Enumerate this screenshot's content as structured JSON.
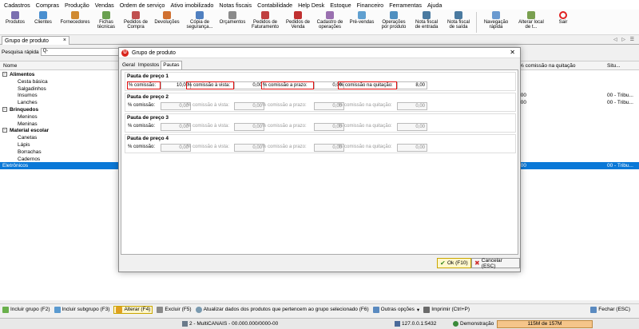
{
  "menubar": [
    "Cadastros",
    "Compras",
    "Produção",
    "Vendas",
    "Ordem de serviço",
    "Ativo imobilizado",
    "Notas fiscais",
    "Contabilidade",
    "Help Desk",
    "Estoque",
    "Financeiro",
    "Ferramentas",
    "Ajuda"
  ],
  "toolbar": [
    {
      "label": "Produtos",
      "icon": "box-icon",
      "color": "#7a6fb0"
    },
    {
      "label": "Clientes",
      "icon": "user-icon",
      "color": "#4a8fd0"
    },
    {
      "label": "Fornecedores",
      "icon": "truck-icon",
      "color": "#d08a30"
    },
    {
      "label": "Fichas\ntécnicas",
      "icon": "sheet-icon",
      "color": "#6aa050"
    },
    {
      "label": "Pedidos de\nCompra",
      "icon": "cart-icon",
      "color": "#c05050"
    },
    {
      "label": "Devoluções",
      "icon": "return-icon",
      "color": "#d07030"
    },
    {
      "label": "Cópia de\nsegurança...",
      "icon": "backup-icon",
      "color": "#5080c0"
    },
    {
      "label": "Orçamentos",
      "icon": "quote-icon",
      "color": "#8a8a8a"
    },
    {
      "label": "Pedidos de\nFaturamento",
      "icon": "invoice-icon",
      "color": "#c04040"
    },
    {
      "label": "Pedidos de\nVenda",
      "icon": "sale-icon",
      "color": "#c03030"
    },
    {
      "label": "Cadastro de\noperações",
      "icon": "ops-icon",
      "color": "#9a70b0"
    },
    {
      "label": "Pré-vendas",
      "icon": "cart-icon",
      "color": "#60a0d0"
    },
    {
      "label": "Operações\npor produto",
      "icon": "ops-product-icon",
      "color": "#5090c0"
    },
    {
      "label": "Nota fiscal\nde entrada",
      "icon": "invoice-in-icon",
      "color": "#4a7aa0"
    },
    {
      "label": "Nota fiscal\nde saída",
      "icon": "invoice-out-icon",
      "color": "#4a7aa0"
    },
    {
      "label": "Navegação\nrápida",
      "icon": "nav-icon",
      "color": "#6a9ad0"
    },
    {
      "label": "Alterar local\nde t...",
      "icon": "home-icon",
      "color": "#7aa050"
    },
    {
      "label": "Sair",
      "icon": "power-icon",
      "color": "#e02020"
    }
  ],
  "tab": {
    "label": "Grupo de produto",
    "close": "×",
    "nav": "◁ ▷ ☰"
  },
  "search": {
    "label": "Pesquisa rápida",
    "value": "Q-"
  },
  "grid": {
    "headers": {
      "name": "Nome",
      "c2": "% comissão na quitação",
      "c3": "Situ..."
    },
    "rows": [
      {
        "name": "Alimentos",
        "level": 0,
        "toggle": "−",
        "c2": "",
        "c3": ""
      },
      {
        "name": "Cesta básica",
        "level": 1,
        "c2": "",
        "c3": ""
      },
      {
        "name": "Salgadinhos",
        "level": 1,
        "c2": "",
        "c3": ""
      },
      {
        "name": "Insumos",
        "level": 1,
        "c2": ",00",
        "c3": "00 - Tribu..."
      },
      {
        "name": "Lanches",
        "level": 1,
        "c2": ",00",
        "c3": "00 - Tribu..."
      },
      {
        "name": "Brinquedos",
        "level": 0,
        "toggle": "−",
        "c2": "",
        "c3": ""
      },
      {
        "name": "Meninos",
        "level": 1,
        "c2": "",
        "c3": ""
      },
      {
        "name": "Meninas",
        "level": 1,
        "c2": "",
        "c3": ""
      },
      {
        "name": "Material escolar",
        "level": 0,
        "toggle": "−",
        "c2": "",
        "c3": ""
      },
      {
        "name": "Canetas",
        "level": 1,
        "c2": "",
        "c3": ""
      },
      {
        "name": "Lápis",
        "level": 1,
        "c2": "",
        "c3": ""
      },
      {
        "name": "Borrachas",
        "level": 1,
        "c2": "",
        "c3": ""
      },
      {
        "name": "Cadernos",
        "level": 1,
        "c2": "",
        "c3": ""
      },
      {
        "name": "Eletrônicos",
        "level": 0,
        "selected": true,
        "c2": ",00",
        "c3": "00 - Tribu..."
      }
    ]
  },
  "dialog": {
    "title": "Grupo de produto",
    "close": "✕",
    "tabs": [
      "Geral",
      "Impostos",
      "Pautas"
    ],
    "active_tab": "Pautas",
    "groups": [
      {
        "title": "Pauta de preço 1",
        "enabled": true,
        "fields": [
          {
            "label": "% comissão:",
            "value": "10,00"
          },
          {
            "label": "% comissão à vista:",
            "value": "0,00"
          },
          {
            "label": "% comissão a prazo:",
            "value": "0,00"
          },
          {
            "label": "% comissão na quitação:",
            "value": "8,00"
          }
        ]
      },
      {
        "title": "Pauta de preço 2",
        "enabled": false,
        "fields": [
          {
            "label": "% comissão:",
            "value": "0,00"
          },
          {
            "label": "% comissão à vista:",
            "value": "0,00"
          },
          {
            "label": "% comissão a prazo:",
            "value": "0,00"
          },
          {
            "label": "% comissão na quitação:",
            "value": "0,00"
          }
        ]
      },
      {
        "title": "Pauta de preço 3",
        "enabled": false,
        "fields": [
          {
            "label": "% comissão:",
            "value": "0,00"
          },
          {
            "label": "% comissão à vista:",
            "value": "0,00"
          },
          {
            "label": "% comissão a prazo:",
            "value": "0,00"
          },
          {
            "label": "% comissão na quitação:",
            "value": "0,00"
          }
        ]
      },
      {
        "title": "Pauta de preço 4",
        "enabled": false,
        "fields": [
          {
            "label": "% comissão:",
            "value": "0,00"
          },
          {
            "label": "% comissão à vista:",
            "value": "0,00"
          },
          {
            "label": "% comissão a prazo:",
            "value": "0,00"
          },
          {
            "label": "% comissão na quitação:",
            "value": "0,00"
          }
        ]
      }
    ],
    "ok_label": "Ok (F10)",
    "cancel_label": "Cancelar (ESC)"
  },
  "bottom_actions": {
    "include_group": "Incluir grupo (F2)",
    "include_subgroup": "Incluir subgrupo  (F3)",
    "alter": "Alterar (F4)",
    "delete": "Excluir (F5)",
    "update": "Atualizar dados dos produtos que pertencem ao grupo selecionado (F6)",
    "other": "Outras opções",
    "print": "Imprimir (Ctrl+P)",
    "close": "Fechar (ESC)"
  },
  "status": {
    "company": "2 - MultiCANAIS - 00.000.000/0000-00",
    "ip": "127.0.0.1:5432",
    "user": "Demonstração",
    "memory": "115M de 157M"
  },
  "colors": {
    "accent": "#0a78d7",
    "highlight": "#e01010",
    "brand": "#d9251c"
  }
}
